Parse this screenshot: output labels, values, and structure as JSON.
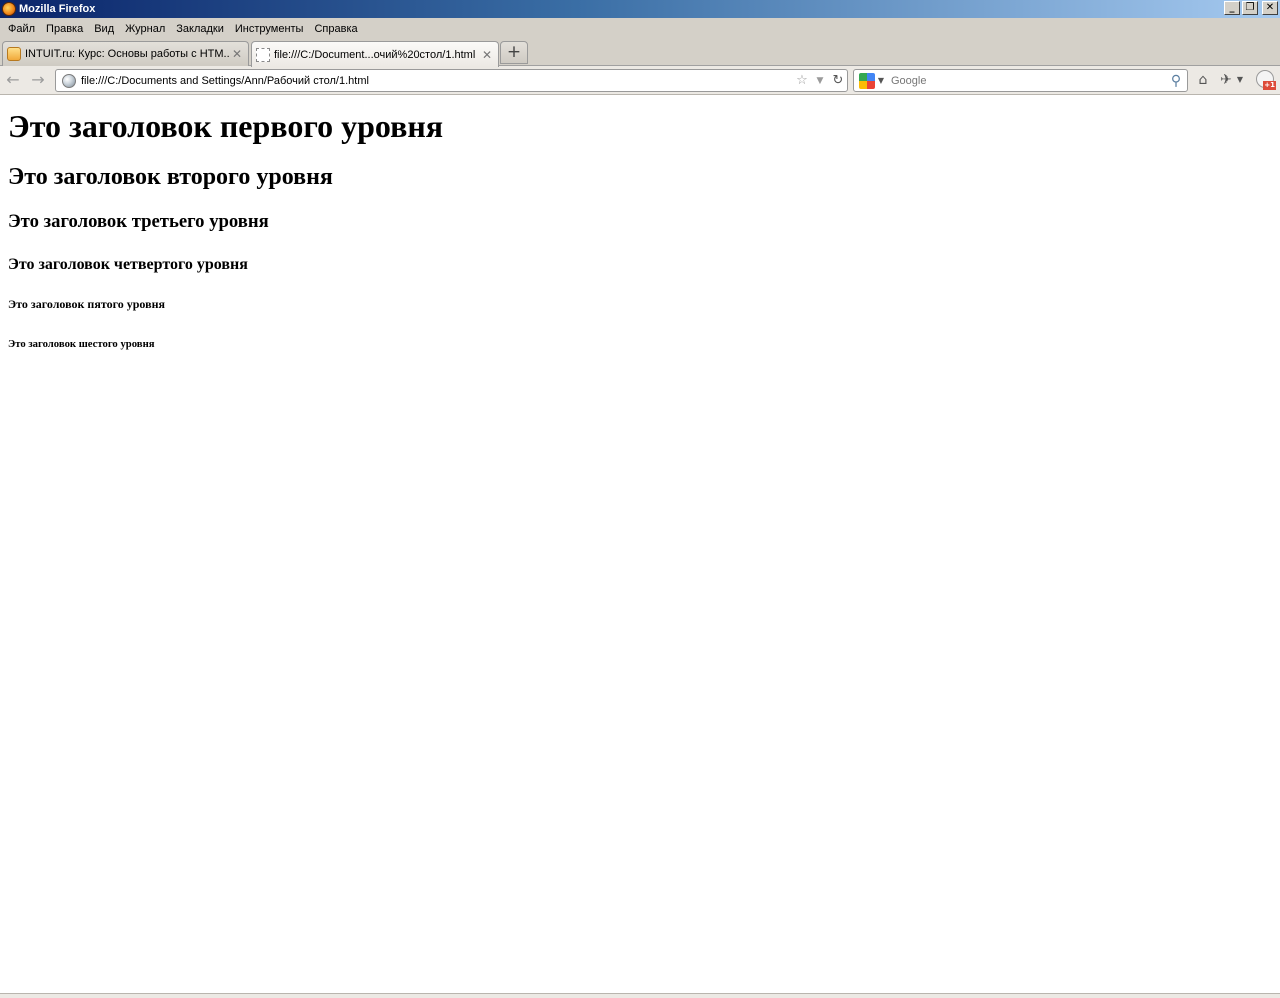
{
  "window": {
    "title": "Mozilla Firefox",
    "buttons": {
      "minimize": "_",
      "restore": "❐",
      "close": "✕"
    }
  },
  "menu": [
    "Файл",
    "Правка",
    "Вид",
    "Журнал",
    "Закладки",
    "Инструменты",
    "Справка"
  ],
  "tabs": [
    {
      "label": "INTUIT.ru: Курс: Основы работы с HTM...",
      "active": false,
      "close": "✕"
    },
    {
      "label": "file:///C:/Document...очий%20стол/1.html",
      "active": true,
      "close": "✕"
    }
  ],
  "new_tab": "+",
  "nav": {
    "back": "←",
    "forward": "→",
    "url": "file:///C:/Documents and Settings/Ann/Рабочий стол/1.html",
    "bookmark_star": "☆",
    "dropdown": "▼",
    "reload": "↻",
    "search_placeholder": "Google",
    "search_go": "⚲",
    "home": "⌂",
    "addon": "✈",
    "addon_drop": "▼"
  },
  "content": {
    "h1": "Это заголовок первого уровня",
    "h2": "Это заголовок второго уровня",
    "h3": "Это заголовок третьего уровня",
    "h4": "Это заголовок четвертого уровня",
    "h5": "Это заголовок пятого уровня",
    "h6": "Это заголовок шестого уровня"
  }
}
